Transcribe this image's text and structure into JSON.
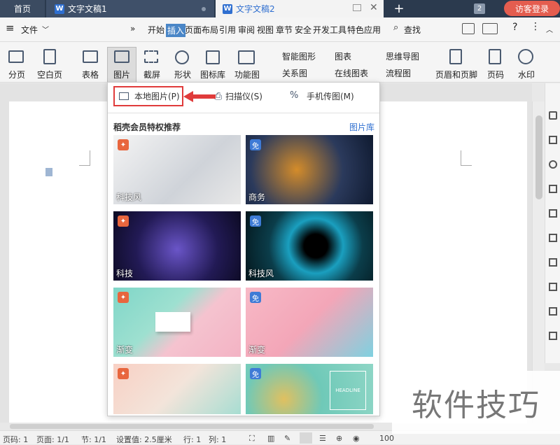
{
  "tabs": {
    "home": "首页",
    "doc1": "文字文稿1",
    "doc2": "文字文稿2",
    "count": "2",
    "login": "访客登录"
  },
  "menubar": {
    "file": "文件",
    "chevron": "»",
    "items": [
      "开始",
      "插入",
      "页面布局",
      "引用",
      "审阅",
      "视图",
      "章节",
      "安全",
      "开发工具",
      "特色应用"
    ],
    "search": "查找"
  },
  "ribbon": {
    "items": [
      "分页",
      "空白页",
      "表格",
      "图片",
      "截屏",
      "形状",
      "图标库",
      "功能图",
      "智能图形",
      "关系图",
      "图表",
      "在线图表",
      "思维导图",
      "流程图",
      "页眉和页脚",
      "页码",
      "水印"
    ]
  },
  "dropdown": {
    "local": "本地图片(P)",
    "scanner": "扫描仪(S)",
    "mobile": "手机传图(M)",
    "section_title": "稻壳会员特权推荐",
    "library": "图片库",
    "thumbs": [
      {
        "label": "科技风",
        "badge": "",
        "badge_type": "fire"
      },
      {
        "label": "商务",
        "badge": "免",
        "badge_type": "free"
      },
      {
        "label": "科技",
        "badge": "",
        "badge_type": "fire"
      },
      {
        "label": "科技风",
        "badge": "免",
        "badge_type": "free"
      },
      {
        "label": "渐变",
        "badge": "",
        "badge_type": "fire"
      },
      {
        "label": "渐变",
        "badge": "免",
        "badge_type": "free"
      },
      {
        "label": "",
        "badge": "",
        "badge_type": "fire"
      },
      {
        "label": "",
        "badge": "免",
        "badge_type": "free"
      }
    ],
    "headline": "HEADLINE"
  },
  "status": {
    "page": "页码: 1",
    "pages": "页面: 1/1",
    "section": "节: 1/1",
    "setting": "设置值: 2.5厘米",
    "row": "行: 1",
    "col": "列: 1",
    "zoom": "100"
  },
  "watermark": "软件技巧",
  "colors": {
    "accent": "#4a86c7",
    "highlight": "#e03b3b",
    "titlebar": "#2b3a4e",
    "login": "#e45d4f"
  }
}
